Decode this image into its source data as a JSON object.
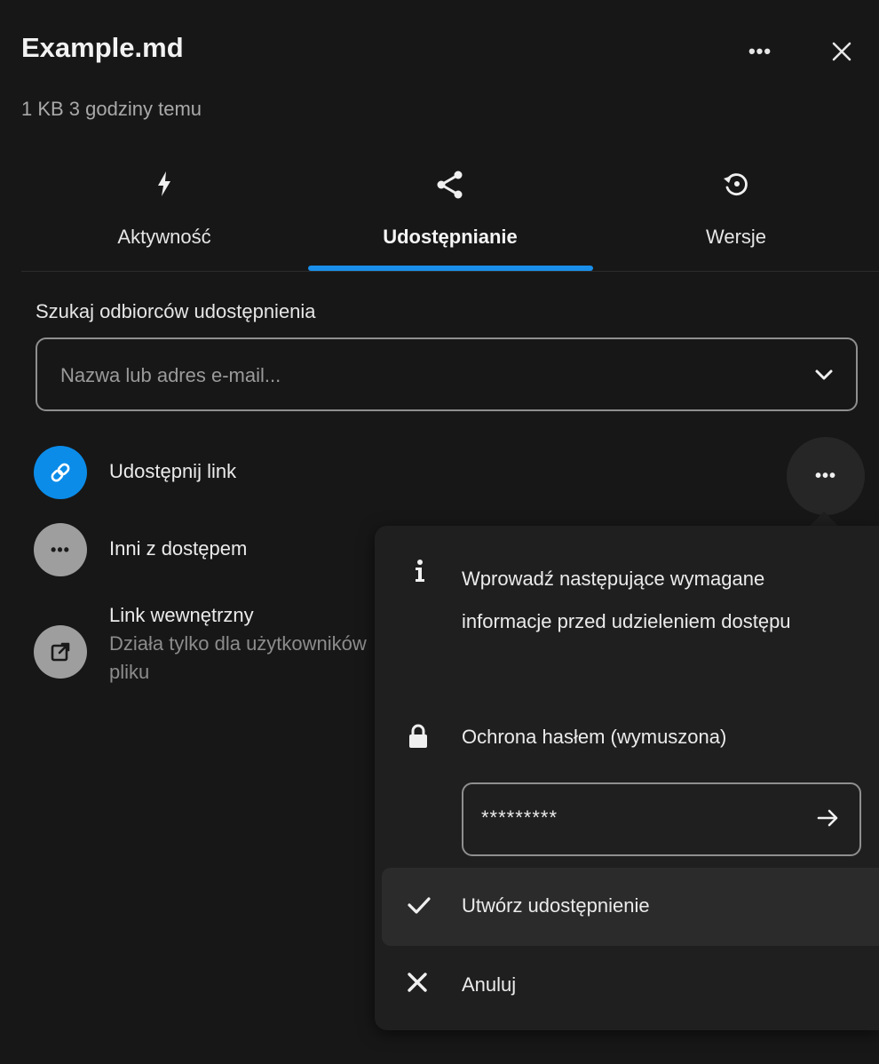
{
  "header": {
    "title": "Example.md",
    "subtitle": "1 KB 3 godziny temu",
    "more_icon": "more-horizontal-icon",
    "close_icon": "close-icon"
  },
  "tabs": [
    {
      "label": "Aktywność",
      "icon": "lightning-icon",
      "active": false
    },
    {
      "label": "Udostępnianie",
      "icon": "share-icon",
      "active": true
    },
    {
      "label": "Wersje",
      "icon": "history-icon",
      "active": false
    }
  ],
  "search": {
    "label": "Szukaj odbiorców udostępnienia",
    "placeholder": "Nazwa lub adres e-mail...",
    "value": ""
  },
  "share_rows": [
    {
      "label": "Udostępnij link",
      "icon": "link-icon",
      "avatar_color": "#0b8ce9"
    },
    {
      "label": "Inni z dostępem",
      "icon": "dots-icon",
      "avatar_color": "#9e9e9e"
    },
    {
      "label": "Link wewnętrzny",
      "sublabel_line1": "Działa tylko dla użytkowników z dostępem do tego",
      "sublabel_line2": "pliku",
      "icon": "external-link-icon",
      "avatar_color": "#9e9e9e"
    }
  ],
  "popover": {
    "info_text": "Wprowadź następujące wymagane informacje przed udzieleniem dostępu",
    "password_label": "Ochrona hasłem (wymuszona)",
    "password_value": "*********",
    "create_label": "Utwórz udostępnienie",
    "cancel_label": "Anuluj"
  },
  "colors": {
    "accent": "#1a8fea",
    "background": "#171717",
    "popover_bg": "#1f1f1f"
  }
}
